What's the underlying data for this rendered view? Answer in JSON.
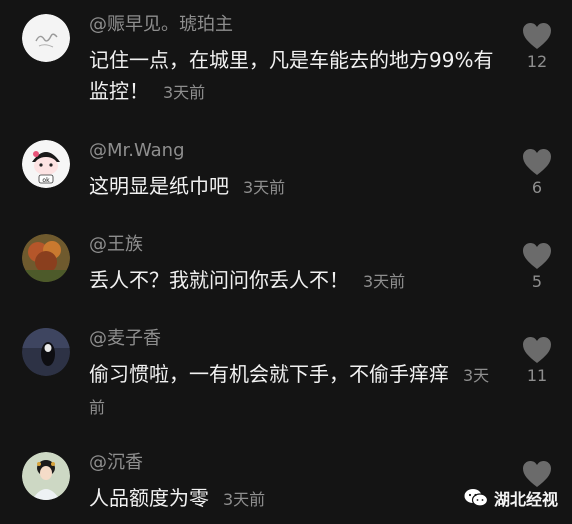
{
  "comments": [
    {
      "username": "@赈早见。琥珀主",
      "text": "记住一点，在城里，凡是车能去的地方99%有监控！",
      "time": "3天前",
      "likes": "12",
      "avatar_icon": "handwriting-avatar-icon"
    },
    {
      "username": "@Mr.Wang",
      "text": "这明显是纸巾吧",
      "time": "3天前",
      "likes": "6",
      "avatar_icon": "cartoon-ok-avatar-icon"
    },
    {
      "username": "@王族",
      "text": "丢人不？我就问问你丢人不！",
      "time": "3天前",
      "likes": "5",
      "avatar_icon": "autumn-tree-avatar-icon"
    },
    {
      "username": "@麦子香",
      "text": "偷习惯啦，一有机会就下手，不偷手痒痒",
      "time": "3天前",
      "likes": "11",
      "avatar_icon": "dark-figure-avatar-icon"
    },
    {
      "username": "@沉香",
      "text": "人品额度为零",
      "time": "3天前",
      "likes": "",
      "avatar_icon": "costume-girl-avatar-icon"
    }
  ],
  "watermark": {
    "label": "湖北经视",
    "icon": "wechat-icon"
  },
  "colors": {
    "background": "#141414",
    "text": "#f2f2f2",
    "muted": "#8e8e8e",
    "heart": "#6b6b6b"
  }
}
